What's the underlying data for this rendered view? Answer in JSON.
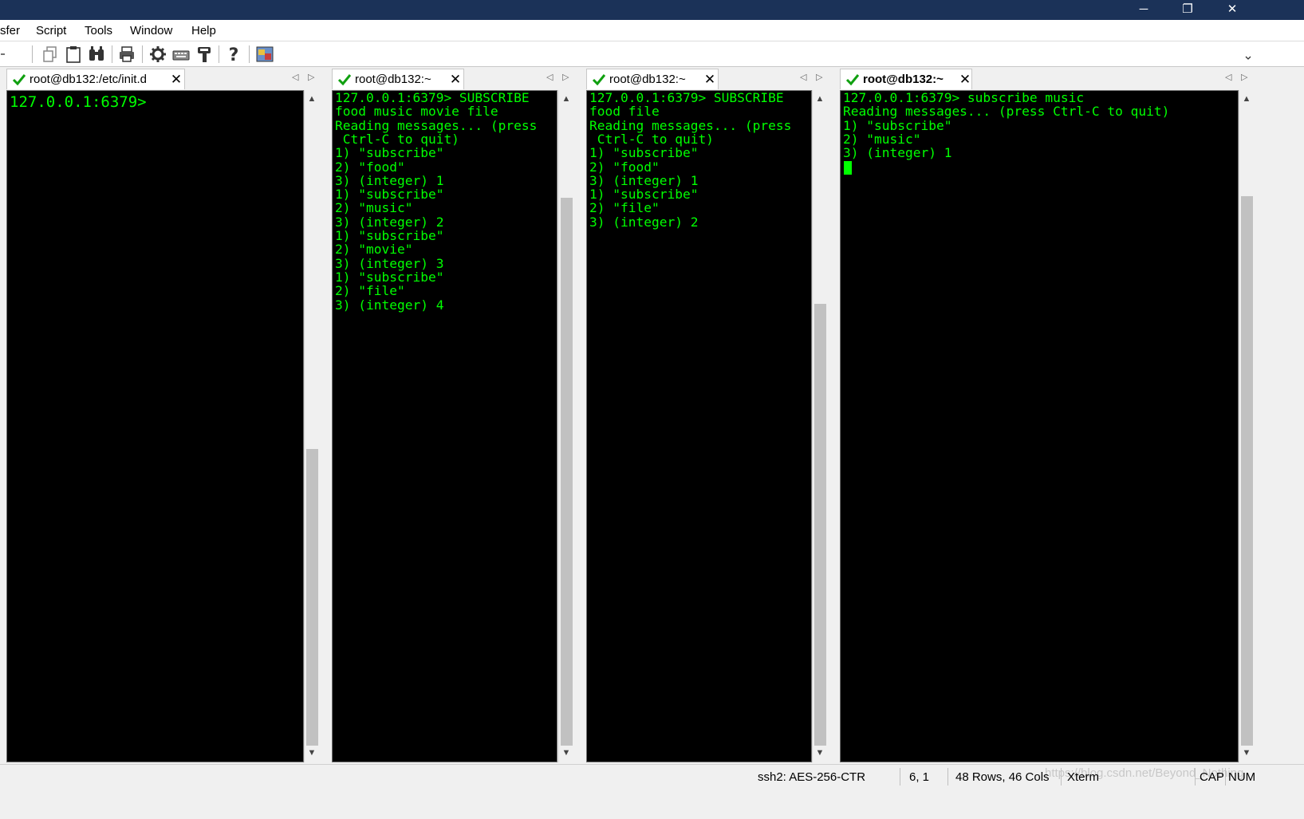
{
  "window": {
    "minimize": "─",
    "restore": "❐",
    "close": "✕"
  },
  "menu": {
    "items": [
      "sfer",
      "Script",
      "Tools",
      "Window",
      "Help"
    ]
  },
  "toolbar": {
    "icons": [
      "copy-icon",
      "paste-icon",
      "find-icon",
      "print-icon",
      "settings-icon",
      "keymap-icon",
      "key-icon",
      "help-icon",
      "sftp-icon"
    ]
  },
  "panes": [
    {
      "tab": "root@db132:/etc/init.d",
      "lines": [
        "127.0.0.1:6379>"
      ]
    },
    {
      "tab": "root@db132:~",
      "lines": [
        "127.0.0.1:6379> SUBSCRIBE",
        "food music movie file",
        "Reading messages... (press",
        " Ctrl-C to quit)",
        "1) \"subscribe\"",
        "2) \"food\"",
        "3) (integer) 1",
        "1) \"subscribe\"",
        "2) \"music\"",
        "3) (integer) 2",
        "1) \"subscribe\"",
        "2) \"movie\"",
        "3) (integer) 3",
        "1) \"subscribe\"",
        "2) \"file\"",
        "3) (integer) 4"
      ]
    },
    {
      "tab": "root@db132:~",
      "lines": [
        "127.0.0.1:6379> SUBSCRIBE",
        "food file",
        "Reading messages... (press",
        " Ctrl-C to quit)",
        "1) \"subscribe\"",
        "2) \"food\"",
        "3) (integer) 1",
        "1) \"subscribe\"",
        "2) \"file\"",
        "3) (integer) 2"
      ]
    },
    {
      "tab": "root@db132:~",
      "lines": [
        "127.0.0.1:6379> subscribe music",
        "Reading messages... (press Ctrl-C to quit)",
        "1) \"subscribe\"",
        "2) \"music\"",
        "3) (integer) 1"
      ]
    }
  ],
  "status": {
    "cipher": "ssh2: AES-256-CTR",
    "position": "6,   1",
    "size": "48 Rows, 46 Cols",
    "term": "Xterm",
    "cap": "CAP",
    "num": "NUM",
    "watermark": "https://blog.csdn.net/Beyond_Nothing"
  },
  "colors": {
    "terminal_fg": "#00ff00",
    "terminal_bg": "#000000",
    "titlebar": "#1b3258"
  }
}
